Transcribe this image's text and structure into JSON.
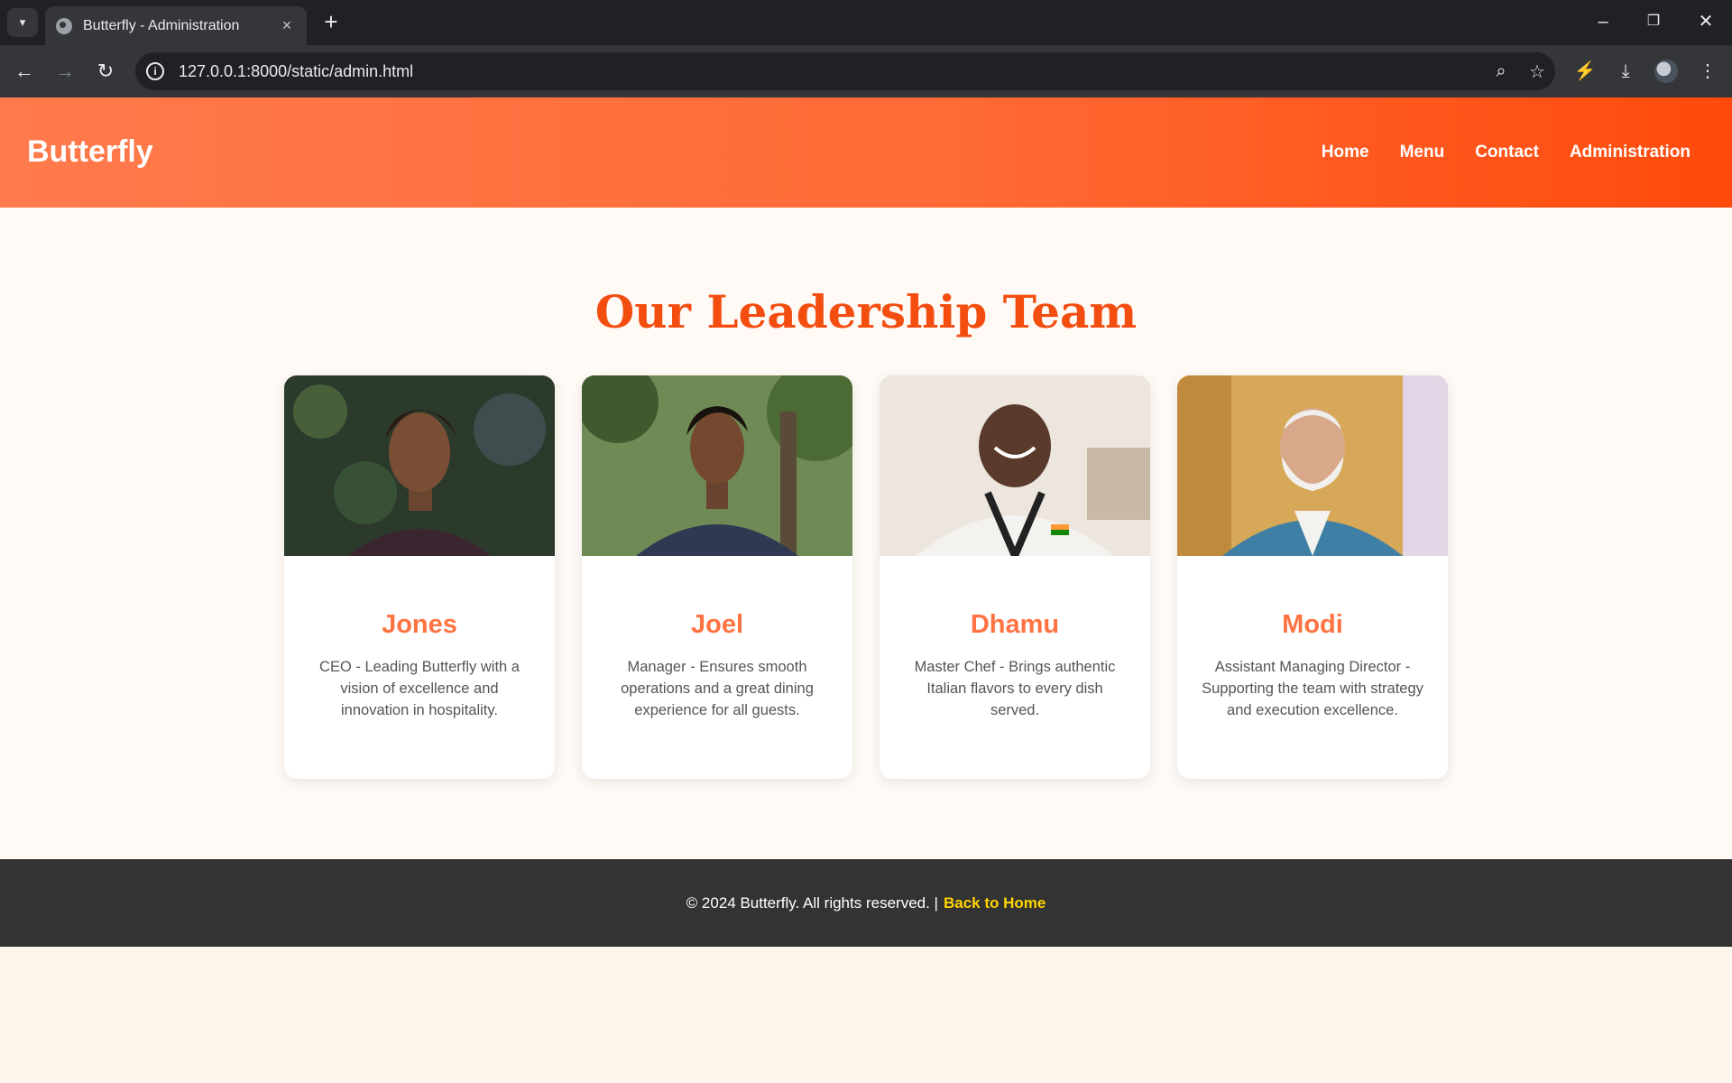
{
  "browser": {
    "tab_title": "Butterfly - Administration",
    "url": "127.0.0.1:8000/static/admin.html"
  },
  "site": {
    "brand": "Butterfly",
    "nav": [
      "Home",
      "Menu",
      "Contact",
      "Administration"
    ]
  },
  "main": {
    "heading": "Our Leadership Team",
    "team": [
      {
        "name": "Jones",
        "description": "CEO - Leading Butterfly with a vision of excellence and innovation in hospitality."
      },
      {
        "name": "Joel",
        "description": "Manager - Ensures smooth operations and a great dining experience for all guests."
      },
      {
        "name": "Dhamu",
        "description": "Master Chef - Brings authentic Italian flavors to every dish served."
      },
      {
        "name": "Modi",
        "description": "Assistant Managing Director - Supporting the team with strategy and execution excellence."
      }
    ]
  },
  "footer": {
    "copyright": "© 2024 Butterfly. All rights reserved. |",
    "back_link": "Back to Home"
  },
  "colors": {
    "header_start": "#ff7a4c",
    "header_end": "#ff4a0c",
    "heading": "#f34d10",
    "name": "#ff7342",
    "footer_bg": "#333333",
    "footer_link": "#ffd400"
  }
}
